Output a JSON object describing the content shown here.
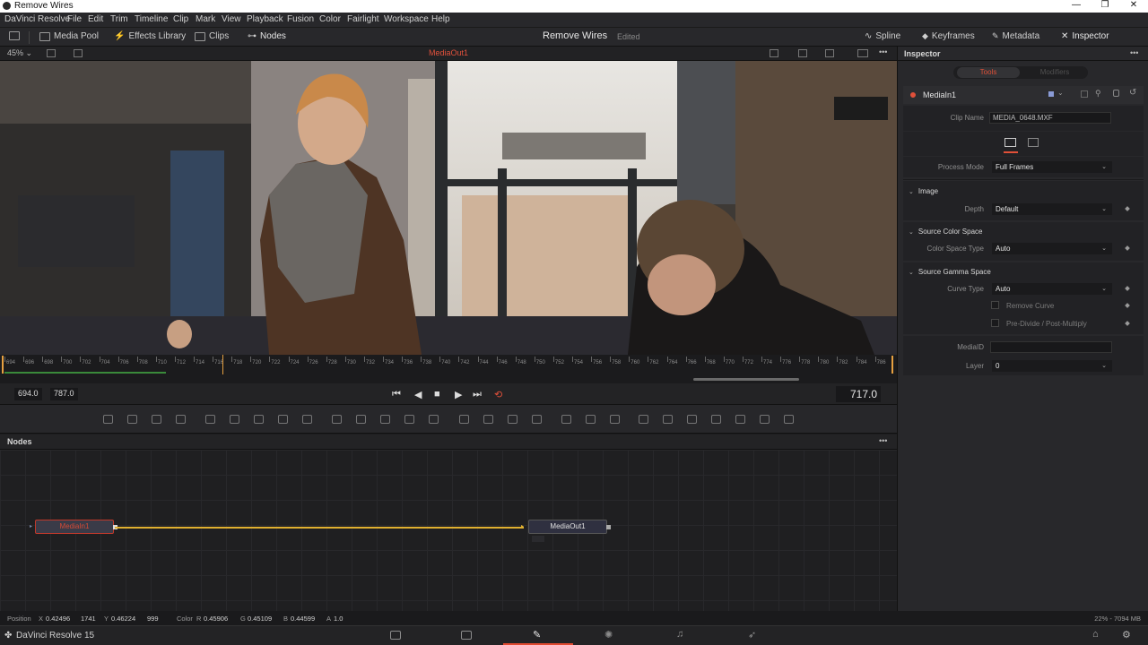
{
  "window": {
    "title": "Remove Wires",
    "controls": [
      "—",
      "❐",
      "✕"
    ]
  },
  "menu": [
    "DaVinci Resolve",
    "File",
    "Edit",
    "Trim",
    "Timeline",
    "Clip",
    "Mark",
    "View",
    "Playback",
    "Fusion",
    "Color",
    "Fairlight",
    "Workspace",
    "Help"
  ],
  "toolbar": {
    "media_pool": "Media Pool",
    "effects_library": "Effects Library",
    "clips": "Clips",
    "nodes": "Nodes",
    "project_title": "Remove Wires",
    "project_status": "Edited",
    "spline": "Spline",
    "keyframes": "Keyframes",
    "metadata": "Metadata",
    "inspector": "Inspector"
  },
  "viewer": {
    "zoom": "45%",
    "label": "MediaOut1"
  },
  "ruler": {
    "labels": [
      "694",
      "696",
      "698",
      "700",
      "702",
      "704",
      "706",
      "708",
      "710",
      "712",
      "714",
      "716",
      "718",
      "720",
      "722",
      "724",
      "726",
      "728",
      "730",
      "732",
      "734",
      "736",
      "738",
      "740",
      "742",
      "744",
      "746",
      "748",
      "750",
      "752",
      "754",
      "756",
      "758",
      "760",
      "762",
      "764",
      "766",
      "768",
      "770",
      "772",
      "774",
      "776",
      "778",
      "780",
      "782",
      "784",
      "786"
    ]
  },
  "transport": {
    "in_point": "694.0",
    "out_point": "787.0",
    "current_frame": "717.0"
  },
  "nodes_panel": {
    "title": "Nodes",
    "menu": "•••",
    "node_in": "MediaIn1",
    "node_out": "MediaOut1"
  },
  "statusbar": {
    "position_label": "Position",
    "x_label": "X",
    "x_val": "0.42496",
    "x_px": "1741",
    "y_label": "Y",
    "y_val": "0.46224",
    "y_px": "999",
    "color_label": "Color",
    "r_label": "R",
    "r_val": "0.45906",
    "g_label": "G",
    "g_val": "0.45109",
    "b_label": "B",
    "b_val": "0.44599",
    "a_label": "A",
    "a_val": "1.0",
    "memory": "22% - 7094 MB"
  },
  "pagebar": {
    "brand": "DaVinci Resolve 15"
  },
  "inspector": {
    "title": "Inspector",
    "menu": "•••",
    "tab_tools": "Tools",
    "tab_modifiers": "Modifiers",
    "tool_name": "MediaIn1",
    "clip_name_label": "Clip Name",
    "clip_name_value": "MEDIA_0648.MXF",
    "process_mode_label": "Process Mode",
    "process_mode_value": "Full Frames",
    "image_section": "Image",
    "depth_label": "Depth",
    "depth_value": "Default",
    "source_color_space_section": "Source Color Space",
    "color_space_type_label": "Color Space Type",
    "color_space_type_value": "Auto",
    "source_gamma_space_section": "Source Gamma Space",
    "curve_type_label": "Curve Type",
    "curve_type_value": "Auto",
    "remove_curve_label": "Remove Curve",
    "predivide_label": "Pre-Divide / Post-Multiply",
    "mediaid_label": "MediaID",
    "mediaid_value": "",
    "layer_label": "Layer",
    "layer_value": "0"
  },
  "colors": {
    "accent": "#e0503a",
    "wire": "#e0b030",
    "playhead": "#e6a040"
  }
}
